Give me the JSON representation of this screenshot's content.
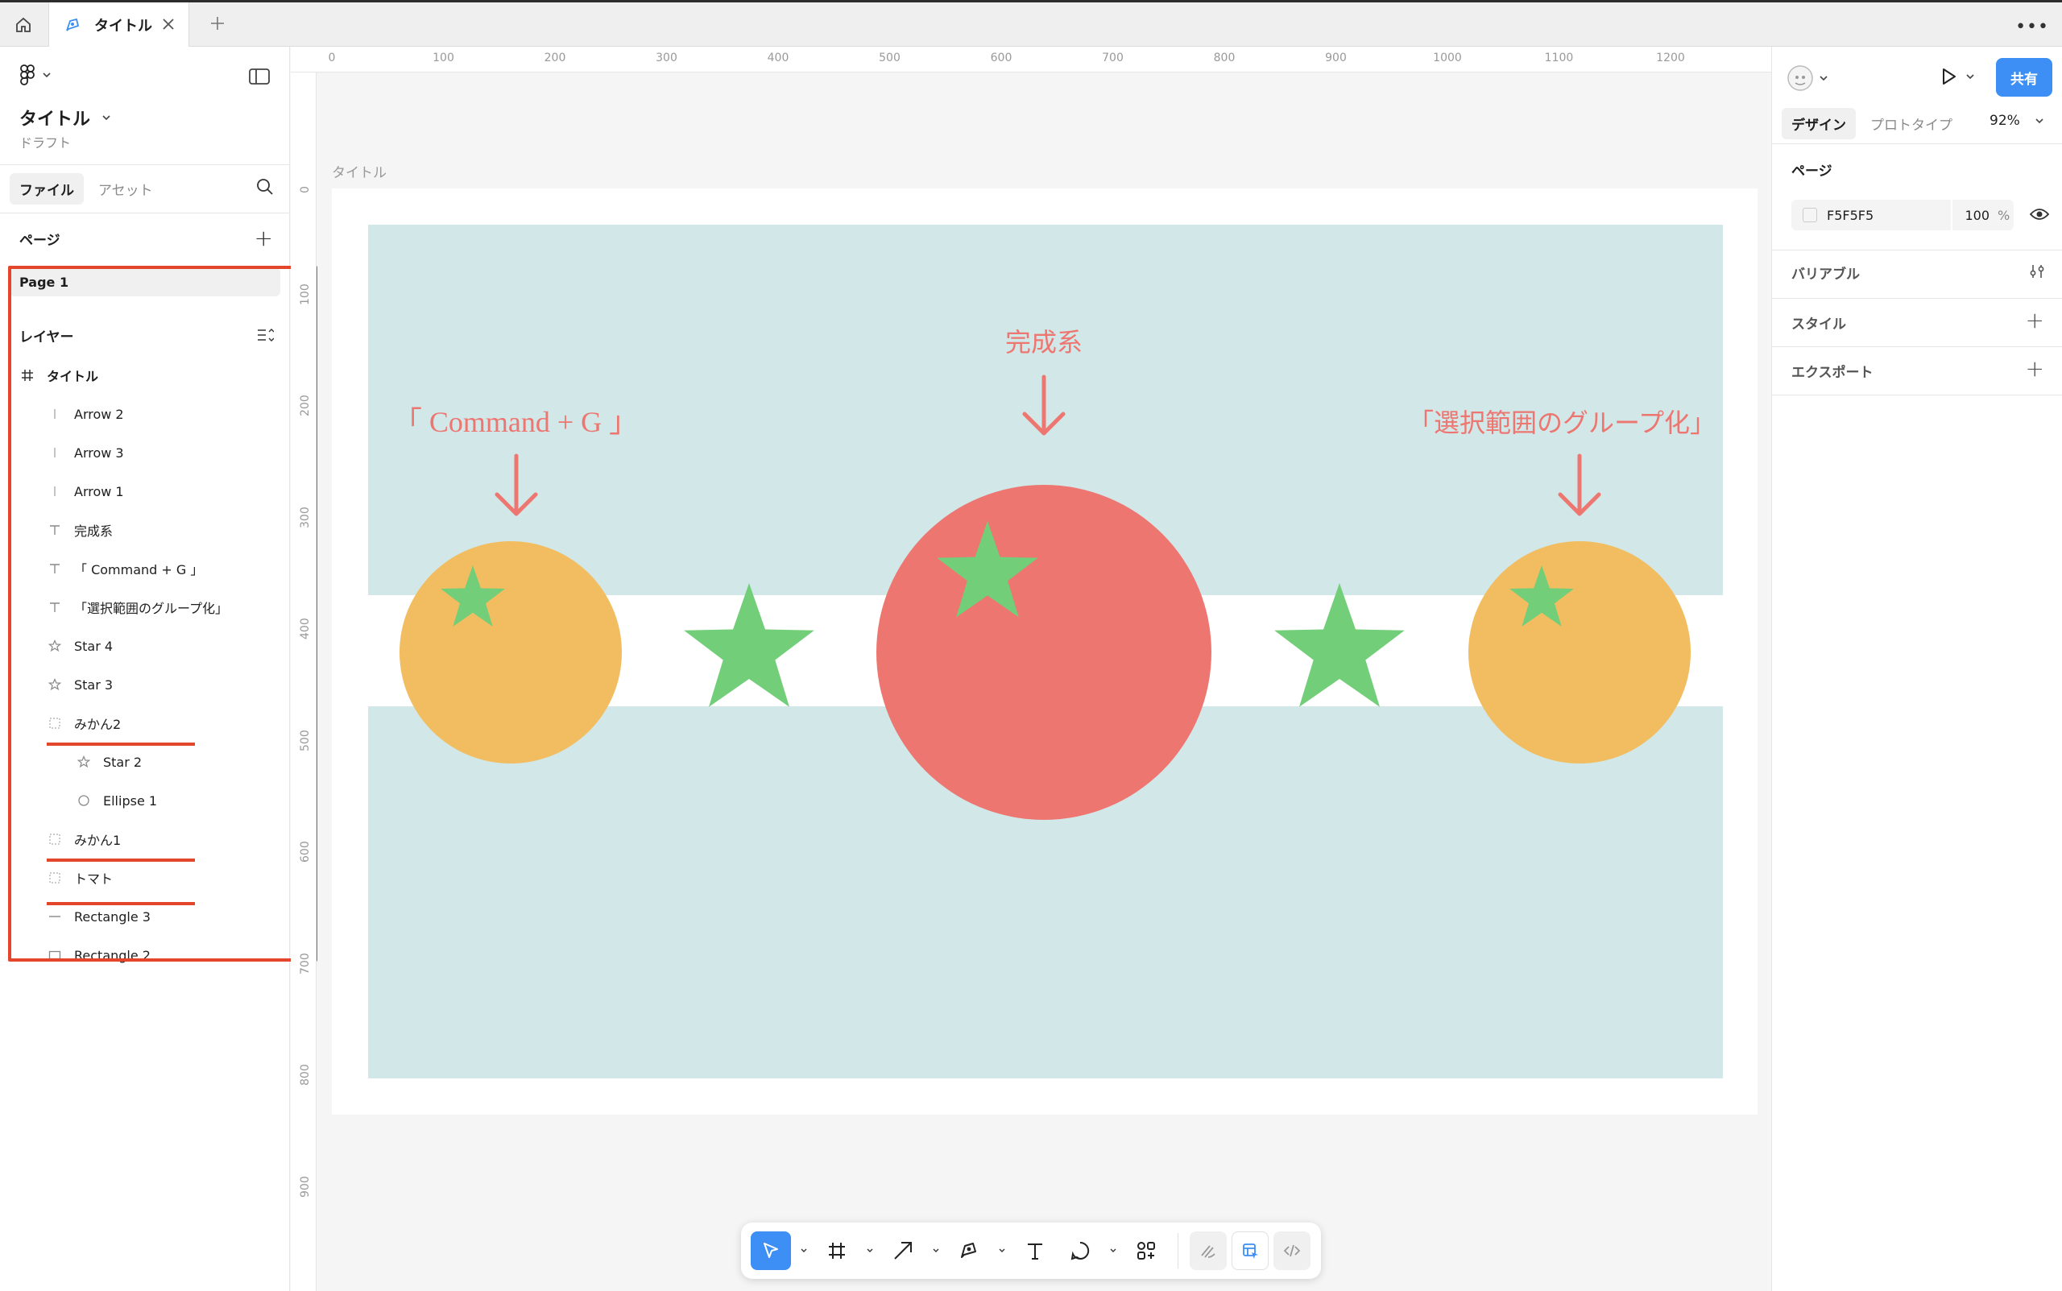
{
  "tabbar": {
    "tab_title": "タイトル"
  },
  "left_panel": {
    "file_title": "タイトル",
    "file_subtitle": "ドラフト",
    "tabs": {
      "file": "ファイル",
      "assets": "アセット"
    },
    "pages_title": "ページ",
    "page_item": "Page 1",
    "layers_title": "レイヤー",
    "layers": [
      {
        "label": "タイトル",
        "icon": "frame-icon"
      },
      {
        "label": "Arrow 2",
        "icon": "arrow-line-icon"
      },
      {
        "label": "Arrow 3",
        "icon": "arrow-line-icon"
      },
      {
        "label": "Arrow 1",
        "icon": "arrow-line-icon"
      },
      {
        "label": "完成系",
        "icon": "text-icon"
      },
      {
        "label": "「 Command + G 」",
        "icon": "text-icon"
      },
      {
        "label": "「選択範囲のグループ化」",
        "icon": "text-icon"
      },
      {
        "label": "Star 4",
        "icon": "star-icon"
      },
      {
        "label": "Star 3",
        "icon": "star-icon"
      },
      {
        "label": "みかん2",
        "icon": "group-icon"
      },
      {
        "label": "Star 2",
        "icon": "star-icon"
      },
      {
        "label": "Ellipse 1",
        "icon": "ellipse-icon"
      },
      {
        "label": "みかん1",
        "icon": "group-icon"
      },
      {
        "label": "トマト",
        "icon": "group-icon"
      },
      {
        "label": "Rectangle 3",
        "icon": "line-icon"
      },
      {
        "label": "Rectangle 2",
        "icon": "rectangle-icon"
      }
    ],
    "highlight_color": "#e4462b"
  },
  "rulers": {
    "top": [
      "0",
      "100",
      "200",
      "300",
      "400",
      "500",
      "600",
      "700",
      "800",
      "900",
      "1000",
      "1100",
      "1200"
    ],
    "left": [
      "0",
      "100",
      "200",
      "300",
      "400",
      "500",
      "600",
      "700",
      "800",
      "900"
    ]
  },
  "canvas": {
    "frame_label": "タイトル",
    "texts": {
      "center": "完成系",
      "left": "「 Command + G 」",
      "right": "「選択範囲のグループ化」"
    },
    "colors": {
      "band": "#d1e7e8",
      "orange": "#f2bd60",
      "tomato": "#ee7670",
      "star": "#72ce79",
      "accent_text": "#ee7670"
    }
  },
  "right_panel": {
    "share_label": "共有",
    "tabs": {
      "design": "デザイン",
      "prototype": "プロトタイプ"
    },
    "zoom": "92%",
    "page_section": "ページ",
    "page_color_hex": "F5F5F5",
    "page_opacity": "100",
    "page_opacity_unit": "%",
    "variables": "バリアブル",
    "styles": "スタイル",
    "export": "エクスポート"
  },
  "help_label": "?"
}
